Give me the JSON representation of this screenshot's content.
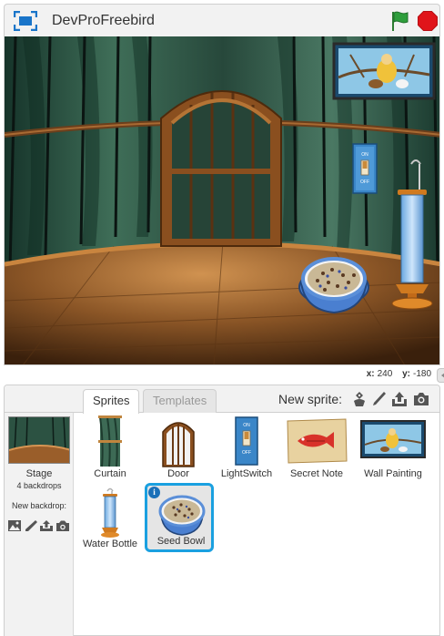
{
  "project": {
    "title": "DevProFreebird"
  },
  "coords": {
    "x_label": "x:",
    "x_value": "240",
    "y_label": "y:",
    "y_value": "-180"
  },
  "stage_scene": {
    "switch_on": "ON",
    "switch_off": "OFF"
  },
  "sprites_panel": {
    "tabs": [
      "Sprites",
      "Templates"
    ],
    "new_sprite_label": "New sprite:",
    "stage": {
      "name": "Stage",
      "backdrops": "4 backdrops",
      "new_backdrop": "New backdrop:"
    },
    "sprites": [
      {
        "name": "Curtain"
      },
      {
        "name": "Door"
      },
      {
        "name": "LightSwitch"
      },
      {
        "name": "Secret Note"
      },
      {
        "name": "Wall Painting"
      },
      {
        "name": "Water Bottle"
      },
      {
        "name": "Seed Bowl",
        "selected": true,
        "info": "i"
      }
    ]
  },
  "icons": {
    "fullscreen": "fullscreen-icon",
    "flag": "green-flag-icon",
    "stop": "stop-icon",
    "sprite_tools": [
      "choose-sprite-icon",
      "paint-icon",
      "upload-icon",
      "camera-icon"
    ],
    "backdrop_tools": [
      "landscape-icon",
      "paint-icon",
      "upload-icon",
      "camera-icon"
    ]
  },
  "colors": {
    "flag": "#2e9e3c",
    "stop": "#e0141a",
    "selected_border": "#1aa0e0",
    "fullscreen": "#1a75c9"
  }
}
